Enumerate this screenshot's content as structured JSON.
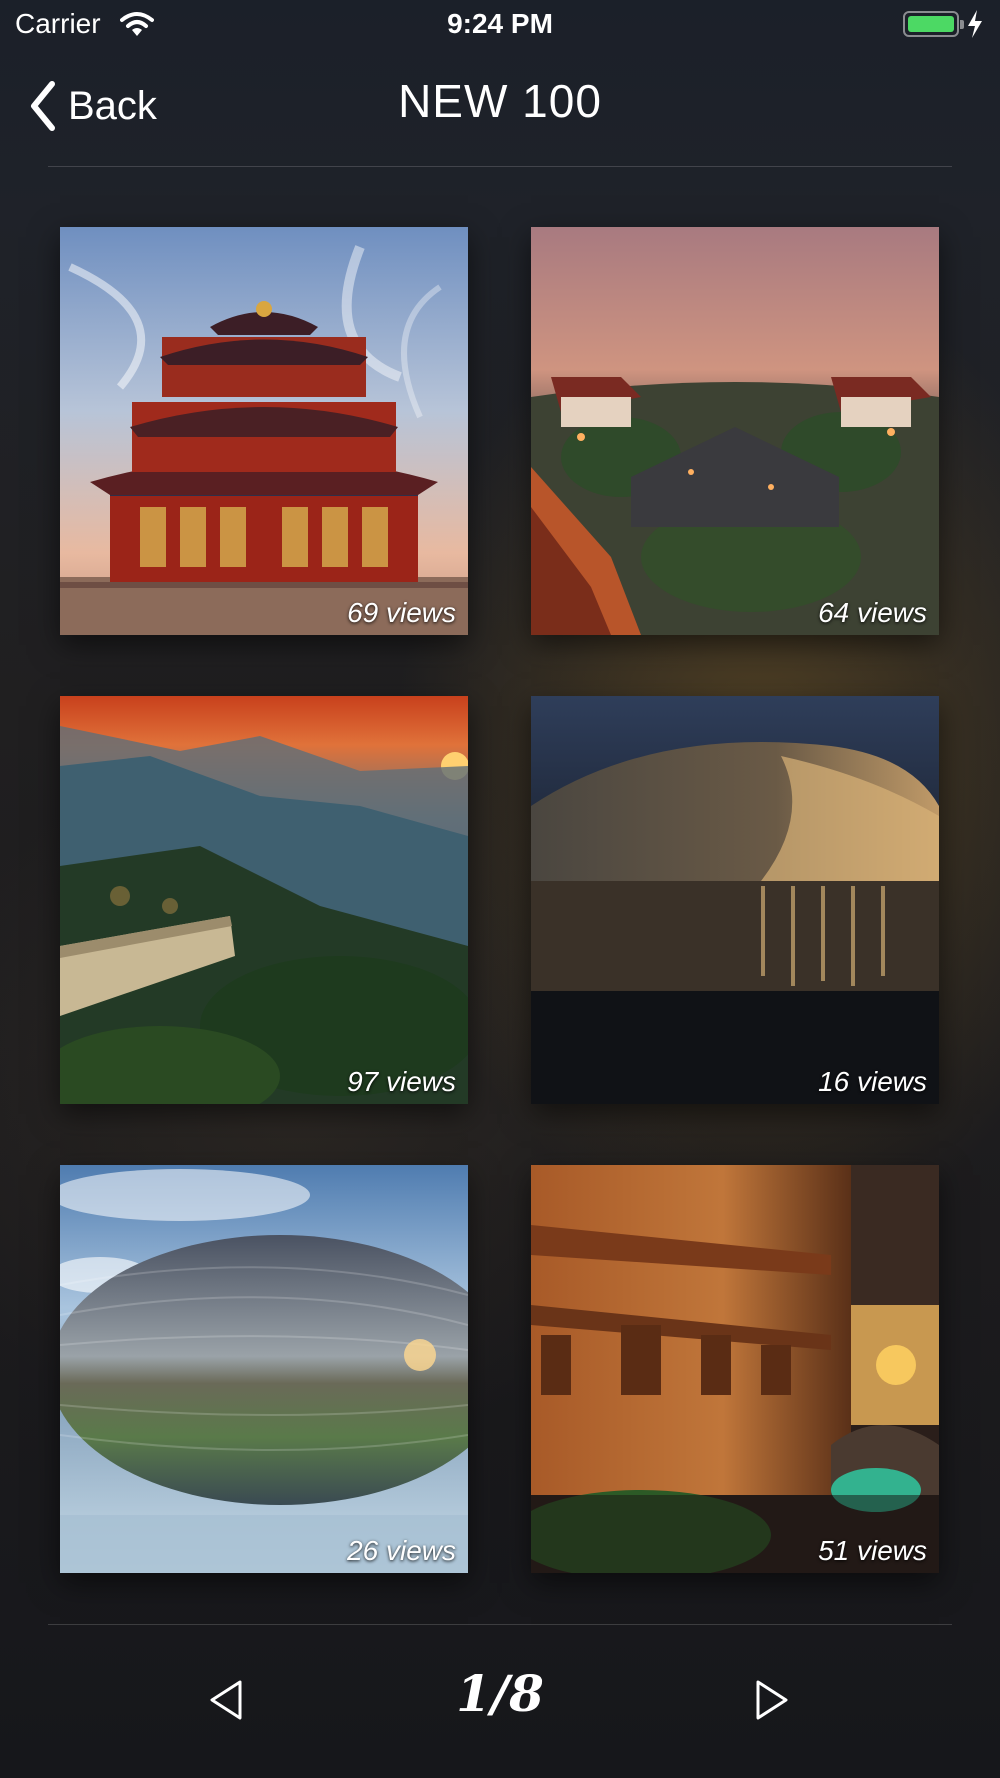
{
  "status_bar": {
    "carrier": "Carrier",
    "time": "9:24 PM",
    "battery_color": "#4cd964"
  },
  "nav": {
    "back_label": "Back",
    "title": "NEW 100"
  },
  "grid": {
    "items": [
      {
        "views": "69 views",
        "subject": "temple-pagoda-image"
      },
      {
        "views": "64 views",
        "subject": "old-town-rooftops-image"
      },
      {
        "views": "97 views",
        "subject": "great-wall-sunset-image"
      },
      {
        "views": "16 views",
        "subject": "opera-house-night-image"
      },
      {
        "views": "26 views",
        "subject": "egg-dome-reflection-image"
      },
      {
        "views": "51 views",
        "subject": "canal-wooden-houses-image"
      }
    ]
  },
  "pager": {
    "indicator": "1/8",
    "prev_icon": "triangle-left-icon",
    "next_icon": "triangle-right-icon"
  }
}
